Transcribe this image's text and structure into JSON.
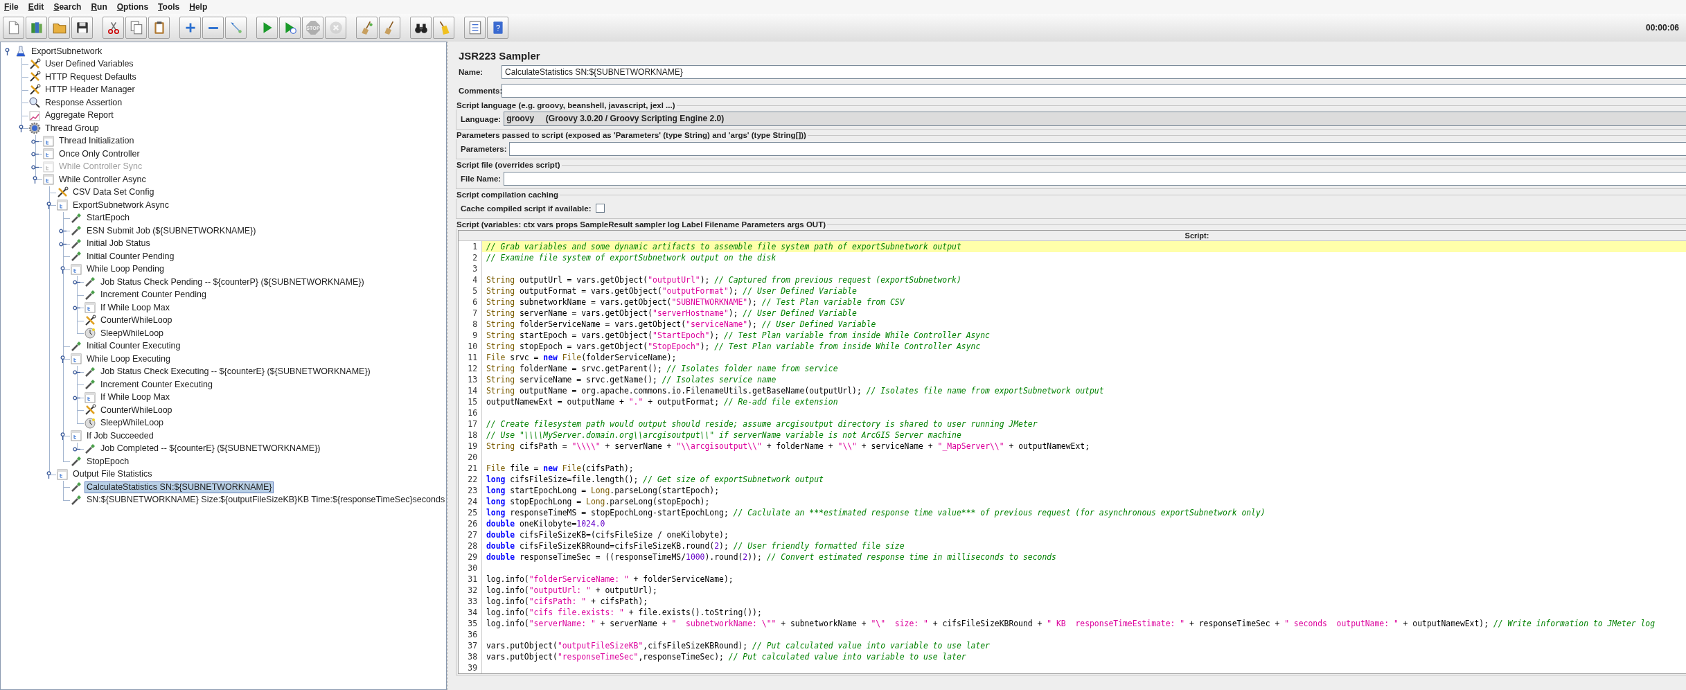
{
  "menu": [
    "File",
    "Edit",
    "Search",
    "Run",
    "Options",
    "Tools",
    "Help"
  ],
  "toolbar": [
    {
      "buttons": [
        {
          "kind": "new",
          "disabled": false
        },
        {
          "kind": "templates",
          "disabled": false
        },
        {
          "kind": "open",
          "disabled": false
        },
        {
          "kind": "save",
          "disabled": false
        }
      ]
    },
    {
      "buttons": [
        {
          "kind": "cut",
          "disabled": false
        },
        {
          "kind": "copy",
          "disabled": false
        },
        {
          "kind": "paste",
          "disabled": false
        }
      ]
    },
    {
      "buttons": [
        {
          "kind": "expand",
          "disabled": false
        },
        {
          "kind": "collapse",
          "disabled": false
        },
        {
          "kind": "toggle",
          "disabled": false
        }
      ]
    },
    {
      "buttons": [
        {
          "kind": "start",
          "disabled": false
        },
        {
          "kind": "start_no_pauses",
          "disabled": false
        },
        {
          "kind": "stop",
          "disabled": true,
          "label": "STOP"
        },
        {
          "kind": "shutdown",
          "disabled": true
        }
      ]
    },
    {
      "buttons": [
        {
          "kind": "clear",
          "disabled": false
        },
        {
          "kind": "clear_all",
          "disabled": false
        }
      ]
    },
    {
      "buttons": [
        {
          "kind": "search",
          "disabled": false
        },
        {
          "kind": "reset_search",
          "disabled": false
        }
      ]
    },
    {
      "buttons": [
        {
          "kind": "function_helper",
          "disabled": false
        },
        {
          "kind": "help",
          "disabled": false,
          "label": "?"
        }
      ]
    }
  ],
  "elapsed_time": "00:00:06",
  "tree": [
    {
      "label": "ExportSubnetwork",
      "kind": "testplan",
      "selected": false,
      "disabled": false,
      "expanded": true,
      "children": [
        {
          "label": "User Defined Variables",
          "kind": "config",
          "selected": false,
          "disabled": false
        },
        {
          "label": "HTTP Request Defaults",
          "kind": "config",
          "selected": false,
          "disabled": false
        },
        {
          "label": "HTTP Header Manager",
          "kind": "config",
          "selected": false,
          "disabled": false
        },
        {
          "label": "Response Assertion",
          "kind": "assertion",
          "selected": false,
          "disabled": false
        },
        {
          "label": "Aggregate Report",
          "kind": "listener",
          "selected": false,
          "disabled": false
        },
        {
          "label": "Thread Group",
          "kind": "threadgroup",
          "selected": false,
          "disabled": false,
          "expanded": true,
          "children": [
            {
              "label": "Thread Initialization",
              "kind": "controller",
              "selected": false,
              "disabled": false,
              "expanded": false
            },
            {
              "label": "Once Only Controller",
              "kind": "controller",
              "selected": false,
              "disabled": false,
              "expanded": false
            },
            {
              "label": "While Controller Sync",
              "kind": "controller",
              "selected": false,
              "disabled": true,
              "expanded": false
            },
            {
              "label": "While Controller Async",
              "kind": "controller",
              "selected": false,
              "disabled": false,
              "expanded": true,
              "children": [
                {
                  "label": "CSV Data Set Config",
                  "kind": "config",
                  "selected": false,
                  "disabled": false
                },
                {
                  "label": "ExportSubnetwork Async",
                  "kind": "controller",
                  "selected": false,
                  "disabled": false,
                  "expanded": true,
                  "children": [
                    {
                      "label": "StartEpoch",
                      "kind": "sampler",
                      "selected": false,
                      "disabled": false
                    },
                    {
                      "label": "ESN Submit Job (${SUBNETWORKNAME})",
                      "kind": "sampler",
                      "selected": false,
                      "disabled": false,
                      "expanded": false
                    },
                    {
                      "label": "Initial Job Status",
                      "kind": "sampler",
                      "selected": false,
                      "disabled": false,
                      "expanded": false
                    },
                    {
                      "label": "Initial Counter Pending",
                      "kind": "sampler",
                      "selected": false,
                      "disabled": false
                    },
                    {
                      "label": "While Loop Pending",
                      "kind": "controller",
                      "selected": false,
                      "disabled": false,
                      "expanded": true,
                      "children": [
                        {
                          "label": "Job Status Check Pending -- ${counterP} (${SUBNETWORKNAME})",
                          "kind": "sampler",
                          "selected": false,
                          "disabled": false,
                          "expanded": false
                        },
                        {
                          "label": "Increment Counter Pending",
                          "kind": "sampler",
                          "selected": false,
                          "disabled": false
                        },
                        {
                          "label": "If While Loop Max",
                          "kind": "controller",
                          "selected": false,
                          "disabled": false,
                          "expanded": false
                        },
                        {
                          "label": "CounterWhileLoop",
                          "kind": "config",
                          "selected": false,
                          "disabled": false
                        },
                        {
                          "label": "SleepWhileLoop",
                          "kind": "timer",
                          "selected": false,
                          "disabled": false
                        }
                      ]
                    },
                    {
                      "label": "Initial Counter Executing",
                      "kind": "sampler",
                      "selected": false,
                      "disabled": false
                    },
                    {
                      "label": "While Loop Executing",
                      "kind": "controller",
                      "selected": false,
                      "disabled": false,
                      "expanded": true,
                      "children": [
                        {
                          "label": "Job Status Check Executing -- ${counterE} (${SUBNETWORKNAME})",
                          "kind": "sampler",
                          "selected": false,
                          "disabled": false,
                          "expanded": false
                        },
                        {
                          "label": "Increment Counter Executing",
                          "kind": "sampler",
                          "selected": false,
                          "disabled": false
                        },
                        {
                          "label": "If While Loop Max",
                          "kind": "controller",
                          "selected": false,
                          "disabled": false,
                          "expanded": false
                        },
                        {
                          "label": "CounterWhileLoop",
                          "kind": "config",
                          "selected": false,
                          "disabled": false
                        },
                        {
                          "label": "SleepWhileLoop",
                          "kind": "timer",
                          "selected": false,
                          "disabled": false
                        }
                      ]
                    },
                    {
                      "label": "If Job Succeeded",
                      "kind": "controller",
                      "selected": false,
                      "disabled": false,
                      "expanded": true,
                      "children": [
                        {
                          "label": "Job Completed -- ${counterE} (${SUBNETWORKNAME})",
                          "kind": "sampler",
                          "selected": false,
                          "disabled": false,
                          "expanded": false
                        }
                      ]
                    },
                    {
                      "label": "StopEpoch",
                      "kind": "sampler",
                      "selected": false,
                      "disabled": false
                    }
                  ]
                },
                {
                  "label": "Output File Statistics",
                  "kind": "controller",
                  "selected": false,
                  "disabled": false,
                  "expanded": true,
                  "children": [
                    {
                      "label": "CalculateStatistics SN:${SUBNETWORKNAME}",
                      "kind": "sampler",
                      "selected": true,
                      "disabled": false
                    },
                    {
                      "label": "SN:${SUBNETWORKNAME} Size:${outputFileSizeKB}KB Time:${responseTimeSec}seconds",
                      "kind": "sampler",
                      "selected": false,
                      "disabled": false
                    }
                  ]
                }
              ]
            }
          ]
        }
      ]
    }
  ],
  "editor": {
    "title": "JSR223 Sampler",
    "name": {
      "label": "Name:",
      "value": "CalculateStatistics SN:${SUBNETWORKNAME}"
    },
    "comments": {
      "label": "Comments:"
    },
    "script_language": {
      "legend": "Script language (e.g. groovy, beanshell, javascript, jexl ...)",
      "label": "Language:",
      "value": "groovy     (Groovy 3.0.20 / Groovy Scripting Engine 2.0)"
    },
    "parameters": {
      "legend": "Parameters passed to script (exposed as 'Parameters' (type String) and 'args' (type String[]))",
      "label": "Parameters:"
    },
    "script_file": {
      "legend": "Script file (overrides script)",
      "label": "File Name:"
    },
    "caching": {
      "legend": "Script compilation caching",
      "label": "Cache compiled script if available:",
      "checked": false
    },
    "script": {
      "legend": "Script (variables: ctx vars props SampleResult sampler log Label Filename Parameters args OUT)",
      "header": "Script:",
      "lines": [
        {
          "number": "1",
          "current": true,
          "segments": [
            {
              "kind": "comment",
              "text": "// Grab variables and some dynamic artifacts to assemble file system path of exportSubnetwork output"
            }
          ]
        },
        {
          "number": "2",
          "current": false,
          "segments": [
            {
              "kind": "comment",
              "text": "// Examine file system of exportSubnetwork output on the disk"
            }
          ]
        },
        {
          "number": "3",
          "current": false
        },
        {
          "number": "4",
          "current": false,
          "segments": [
            {
              "kind": "type",
              "text": "String"
            },
            {
              "kind": "plain",
              "text": " outputUrl = vars.getObject("
            },
            {
              "kind": "string",
              "text": "\"outputUrl\""
            },
            {
              "kind": "plain",
              "text": "); "
            },
            {
              "kind": "comment",
              "text": "// Captured from previous request (exportSubnetwork)"
            }
          ]
        },
        {
          "number": "5",
          "current": false,
          "segments": [
            {
              "kind": "type",
              "text": "String"
            },
            {
              "kind": "plain",
              "text": " outputFormat = vars.getObject("
            },
            {
              "kind": "string",
              "text": "\"outputFormat\""
            },
            {
              "kind": "plain",
              "text": "); "
            },
            {
              "kind": "comment",
              "text": "// User Defined Variable"
            }
          ]
        },
        {
          "number": "6",
          "current": false,
          "segments": [
            {
              "kind": "type",
              "text": "String"
            },
            {
              "kind": "plain",
              "text": " subnetworkName = vars.getObject("
            },
            {
              "kind": "string",
              "text": "\"SUBNETWORKNAME\""
            },
            {
              "kind": "plain",
              "text": "); "
            },
            {
              "kind": "comment",
              "text": "// Test Plan variable from CSV"
            }
          ]
        },
        {
          "number": "7",
          "current": false,
          "segments": [
            {
              "kind": "type",
              "text": "String"
            },
            {
              "kind": "plain",
              "text": " serverName = vars.getObject("
            },
            {
              "kind": "string",
              "text": "\"serverHostname\""
            },
            {
              "kind": "plain",
              "text": "); "
            },
            {
              "kind": "comment",
              "text": "// User Defined Variable"
            }
          ]
        },
        {
          "number": "8",
          "current": false,
          "segments": [
            {
              "kind": "type",
              "text": "String"
            },
            {
              "kind": "plain",
              "text": " folderServiceName = vars.getObject("
            },
            {
              "kind": "string",
              "text": "\"serviceName\""
            },
            {
              "kind": "plain",
              "text": "); "
            },
            {
              "kind": "comment",
              "text": "// User Defined Variable"
            }
          ]
        },
        {
          "number": "9",
          "current": false,
          "segments": [
            {
              "kind": "type",
              "text": "String"
            },
            {
              "kind": "plain",
              "text": " startEpoch = vars.getObject("
            },
            {
              "kind": "string",
              "text": "\"StartEpoch\""
            },
            {
              "kind": "plain",
              "text": "); "
            },
            {
              "kind": "comment",
              "text": "// Test Plan variable from inside While Controller Async"
            }
          ]
        },
        {
          "number": "10",
          "current": false,
          "segments": [
            {
              "kind": "type",
              "text": "String"
            },
            {
              "kind": "plain",
              "text": " stopEpoch = vars.getObject("
            },
            {
              "kind": "string",
              "text": "\"StopEpoch\""
            },
            {
              "kind": "plain",
              "text": "); "
            },
            {
              "kind": "comment",
              "text": "// Test Plan variable from inside While Controller Async"
            }
          ]
        },
        {
          "number": "11",
          "current": false,
          "segments": [
            {
              "kind": "type",
              "text": "File"
            },
            {
              "kind": "plain",
              "text": " srvc = "
            },
            {
              "kind": "keyword",
              "text": "new "
            },
            {
              "kind": "type",
              "text": "File"
            },
            {
              "kind": "plain",
              "text": "(folderServiceName);"
            }
          ]
        },
        {
          "number": "12",
          "current": false,
          "segments": [
            {
              "kind": "type",
              "text": "String"
            },
            {
              "kind": "plain",
              "text": " folderName = srvc.getParent(); "
            },
            {
              "kind": "comment",
              "text": "// Isolates folder name from service"
            }
          ]
        },
        {
          "number": "13",
          "current": false,
          "segments": [
            {
              "kind": "type",
              "text": "String"
            },
            {
              "kind": "plain",
              "text": " serviceName = srvc.getName(); "
            },
            {
              "kind": "comment",
              "text": "// Isolates service name"
            }
          ]
        },
        {
          "number": "14",
          "current": false,
          "segments": [
            {
              "kind": "type",
              "text": "String"
            },
            {
              "kind": "plain",
              "text": " outputName = org.apache.commons.io.FilenameUtils.getBaseName(outputUrl); "
            },
            {
              "kind": "comment",
              "text": "// Isolates file name from exportSubnetwork output"
            }
          ]
        },
        {
          "number": "15",
          "current": false,
          "segments": [
            {
              "kind": "plain",
              "text": "outputNamewExt = outputName + "
            },
            {
              "kind": "string",
              "text": "\".\""
            },
            {
              "kind": "plain",
              "text": " + outputFormat; "
            },
            {
              "kind": "comment",
              "text": "// Re-add file extension"
            }
          ]
        },
        {
          "number": "16",
          "current": false
        },
        {
          "number": "17",
          "current": false,
          "segments": [
            {
              "kind": "comment",
              "text": "// Create filesystem path would output should reside; assume arcgisoutput directory is shared to user running JMeter"
            }
          ]
        },
        {
          "number": "18",
          "current": false,
          "segments": [
            {
              "kind": "comment",
              "text": "// Use \"\\\\\\\\MyServer.domain.org\\\\arcgisoutput\\\\\" if serverName variable is not ArcGIS Server machine"
            }
          ]
        },
        {
          "number": "19",
          "current": false,
          "segments": [
            {
              "kind": "type",
              "text": "String"
            },
            {
              "kind": "plain",
              "text": " cifsPath = "
            },
            {
              "kind": "string",
              "text": "\"\\\\\\\\\""
            },
            {
              "kind": "plain",
              "text": " + serverName + "
            },
            {
              "kind": "string",
              "text": "\"\\\\arcgisoutput\\\\\""
            },
            {
              "kind": "plain",
              "text": " + folderName + "
            },
            {
              "kind": "string",
              "text": "\"\\\\\""
            },
            {
              "kind": "plain",
              "text": " + serviceName + "
            },
            {
              "kind": "string",
              "text": "\"_MapServer\\\\\""
            },
            {
              "kind": "plain",
              "text": " + outputNamewExt;"
            }
          ]
        },
        {
          "number": "20",
          "current": false
        },
        {
          "number": "21",
          "current": false,
          "segments": [
            {
              "kind": "type",
              "text": "File"
            },
            {
              "kind": "plain",
              "text": " file = "
            },
            {
              "kind": "keyword",
              "text": "new "
            },
            {
              "kind": "type",
              "text": "File"
            },
            {
              "kind": "plain",
              "text": "(cifsPath);"
            }
          ]
        },
        {
          "number": "22",
          "current": false,
          "segments": [
            {
              "kind": "keyword",
              "text": "long"
            },
            {
              "kind": "plain",
              "text": " cifsFileSize=file.length(); "
            },
            {
              "kind": "comment",
              "text": "// Get size of exportSubnetwork output"
            }
          ]
        },
        {
          "number": "23",
          "current": false,
          "segments": [
            {
              "kind": "keyword",
              "text": "long"
            },
            {
              "kind": "plain",
              "text": " startEpochLong = "
            },
            {
              "kind": "type",
              "text": "Long"
            },
            {
              "kind": "plain",
              "text": ".parseLong(startEpoch);"
            }
          ]
        },
        {
          "number": "24",
          "current": false,
          "segments": [
            {
              "kind": "keyword",
              "text": "long"
            },
            {
              "kind": "plain",
              "text": " stopEpochLong = "
            },
            {
              "kind": "type",
              "text": "Long"
            },
            {
              "kind": "plain",
              "text": ".parseLong(stopEpoch);"
            }
          ]
        },
        {
          "number": "25",
          "current": false,
          "segments": [
            {
              "kind": "keyword",
              "text": "long"
            },
            {
              "kind": "plain",
              "text": " responseTimeMS = stopEpochLong-startEpochLong; "
            },
            {
              "kind": "comment",
              "text": "// Caclulate an ***estimated response time value*** of previous request (for asynchronous exportSubnetwork only)"
            }
          ]
        },
        {
          "number": "26",
          "current": false,
          "segments": [
            {
              "kind": "keyword",
              "text": "double"
            },
            {
              "kind": "plain",
              "text": " oneKilobyte="
            },
            {
              "kind": "number",
              "text": "1024.0"
            }
          ]
        },
        {
          "number": "27",
          "current": false,
          "segments": [
            {
              "kind": "keyword",
              "text": "double"
            },
            {
              "kind": "plain",
              "text": " cifsFileSizeKB=(cifsFileSize / oneKilobyte);"
            }
          ]
        },
        {
          "number": "28",
          "current": false,
          "segments": [
            {
              "kind": "keyword",
              "text": "double"
            },
            {
              "kind": "plain",
              "text": " cifsFileSizeKBRound=cifsFileSizeKB.round("
            },
            {
              "kind": "number",
              "text": "2"
            },
            {
              "kind": "plain",
              "text": "); "
            },
            {
              "kind": "comment",
              "text": "// User friendly formatted file size"
            }
          ]
        },
        {
          "number": "29",
          "current": false,
          "segments": [
            {
              "kind": "keyword",
              "text": "double"
            },
            {
              "kind": "plain",
              "text": " responseTimeSec = ((responseTimeMS/"
            },
            {
              "kind": "number",
              "text": "1000"
            },
            {
              "kind": "plain",
              "text": ").round("
            },
            {
              "kind": "number",
              "text": "2"
            },
            {
              "kind": "plain",
              "text": ")); "
            },
            {
              "kind": "comment",
              "text": "// Convert estimated response time in milliseconds to seconds"
            }
          ]
        },
        {
          "number": "30",
          "current": false
        },
        {
          "number": "31",
          "current": false,
          "segments": [
            {
              "kind": "plain",
              "text": "log.info("
            },
            {
              "kind": "string",
              "text": "\"folderServiceName: \""
            },
            {
              "kind": "plain",
              "text": " + folderServiceName);"
            }
          ]
        },
        {
          "number": "32",
          "current": false,
          "segments": [
            {
              "kind": "plain",
              "text": "log.info("
            },
            {
              "kind": "string",
              "text": "\"outputUrl: \""
            },
            {
              "kind": "plain",
              "text": " + outputUrl);"
            }
          ]
        },
        {
          "number": "33",
          "current": false,
          "segments": [
            {
              "kind": "plain",
              "text": "log.info("
            },
            {
              "kind": "string",
              "text": "\"cifsPath: \""
            },
            {
              "kind": "plain",
              "text": " + cifsPath);"
            }
          ]
        },
        {
          "number": "34",
          "current": false,
          "segments": [
            {
              "kind": "plain",
              "text": "log.info("
            },
            {
              "kind": "string",
              "text": "\"cifs file.exists: \""
            },
            {
              "kind": "plain",
              "text": " + file.exists().toString());"
            }
          ]
        },
        {
          "number": "35",
          "current": false,
          "segments": [
            {
              "kind": "plain",
              "text": "log.info("
            },
            {
              "kind": "string",
              "text": "\"serverName: \""
            },
            {
              "kind": "plain",
              "text": " + serverName + "
            },
            {
              "kind": "string",
              "text": "\"  subnetworkName: \\\"\""
            },
            {
              "kind": "plain",
              "text": " + subnetworkName + "
            },
            {
              "kind": "string",
              "text": "\"\\\"  size: \""
            },
            {
              "kind": "plain",
              "text": " + cifsFileSizeKBRound + "
            },
            {
              "kind": "string",
              "text": "\" KB  responseTimeEstimate: \""
            },
            {
              "kind": "plain",
              "text": " + responseTimeSec + "
            },
            {
              "kind": "string",
              "text": "\" seconds  outputName: \""
            },
            {
              "kind": "plain",
              "text": " + outputNamewExt); "
            },
            {
              "kind": "comment",
              "text": "// Write information to JMeter log"
            }
          ]
        },
        {
          "number": "36",
          "current": false
        },
        {
          "number": "37",
          "current": false,
          "segments": [
            {
              "kind": "plain",
              "text": "vars.putObject("
            },
            {
              "kind": "string",
              "text": "\"outputFileSizeKB\""
            },
            {
              "kind": "plain",
              "text": ",cifsFileSizeKBRound); "
            },
            {
              "kind": "comment",
              "text": "// Put calculated value into variable to use later"
            }
          ]
        },
        {
          "number": "38",
          "current": false,
          "segments": [
            {
              "kind": "plain",
              "text": "vars.putObject("
            },
            {
              "kind": "string",
              "text": "\"responseTimeSec\""
            },
            {
              "kind": "plain",
              "text": ",responseTimeSec); "
            },
            {
              "kind": "comment",
              "text": "// Put calculated value into variable to use later"
            }
          ]
        },
        {
          "number": "39",
          "current": false
        }
      ]
    }
  }
}
